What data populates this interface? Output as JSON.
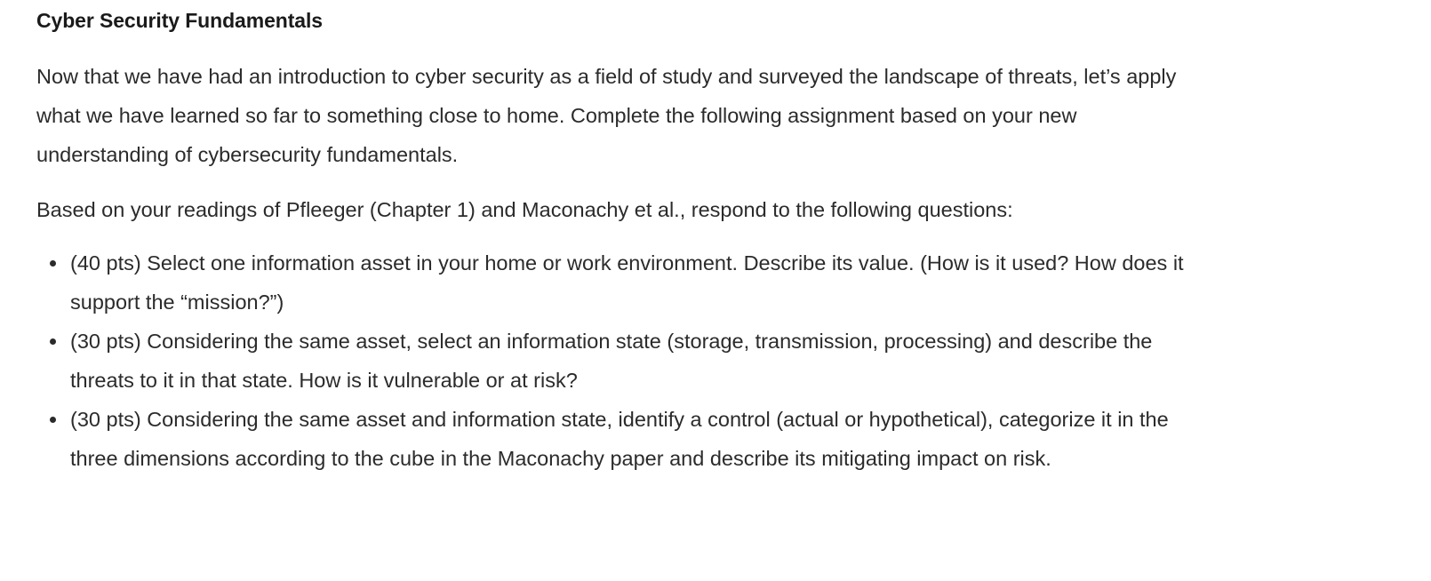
{
  "document": {
    "title": "Cyber Security Fundamentals",
    "paragraphs": [
      "Now that we have had an introduction to cyber security as a field of study and surveyed the landscape of threats, let’s apply what we have learned so far to something close to home. Complete the following assignment based on your new understanding of cybersecurity fundamentals.",
      "Based on your readings of Pfleeger (Chapter 1) and Maconachy et al., respond to the following questions:"
    ],
    "questions": [
      "(40 pts) Select one information asset in your home or work environment. Describe its value. (How is it used? How does it support the “mission?”)",
      "(30 pts) Considering the same asset, select an information state (storage, transmission, processing) and describe the threats to it in that state. How is it vulnerable or at risk?",
      "(30 pts) Considering the same asset and information state, identify a control (actual or hypothetical), categorize it in the three dimensions according to the cube in the Maconachy paper and describe its mitigating impact on risk."
    ],
    "colors": {
      "background": "#ffffff",
      "heading_text": "#1a1a1a",
      "body_text": "#2b2b2b",
      "bullet_marker": "#2b2b2b"
    }
  }
}
